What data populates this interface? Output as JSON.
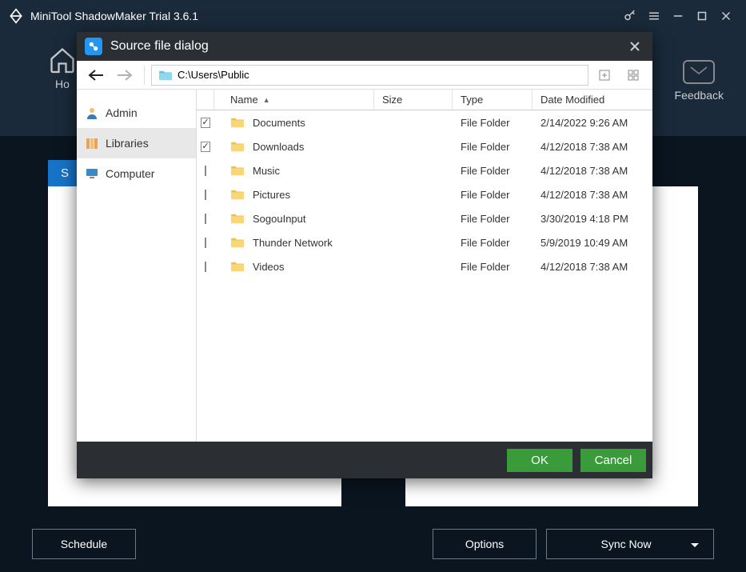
{
  "titlebar": {
    "title": "MiniTool ShadowMaker Trial 3.6.1"
  },
  "nav": {
    "home": "Ho",
    "feedback": "Feedback"
  },
  "main": {
    "source_initial": "S"
  },
  "bottom": {
    "schedule": "Schedule",
    "options": "Options",
    "sync_now": "Sync Now"
  },
  "dialog": {
    "title": "Source file dialog",
    "path": "C:\\Users\\Public",
    "tree": {
      "admin": "Admin",
      "libraries": "Libraries",
      "computer": "Computer"
    },
    "columns": {
      "name": "Name",
      "size": "Size",
      "type": "Type",
      "date": "Date Modified"
    },
    "rows": [
      {
        "checked": true,
        "name": "Documents",
        "type": "File Folder",
        "date": "2/14/2022 9:26 AM"
      },
      {
        "checked": true,
        "name": "Downloads",
        "type": "File Folder",
        "date": "4/12/2018 7:38 AM"
      },
      {
        "checked": false,
        "name": "Music",
        "type": "File Folder",
        "date": "4/12/2018 7:38 AM"
      },
      {
        "checked": false,
        "name": "Pictures",
        "type": "File Folder",
        "date": "4/12/2018 7:38 AM"
      },
      {
        "checked": false,
        "name": "SogouInput",
        "type": "File Folder",
        "date": "3/30/2019 4:18 PM"
      },
      {
        "checked": false,
        "name": "Thunder Network",
        "type": "File Folder",
        "date": "5/9/2019 10:49 AM"
      },
      {
        "checked": false,
        "name": "Videos",
        "type": "File Folder",
        "date": "4/12/2018 7:38 AM"
      }
    ],
    "ok": "OK",
    "cancel": "Cancel"
  }
}
